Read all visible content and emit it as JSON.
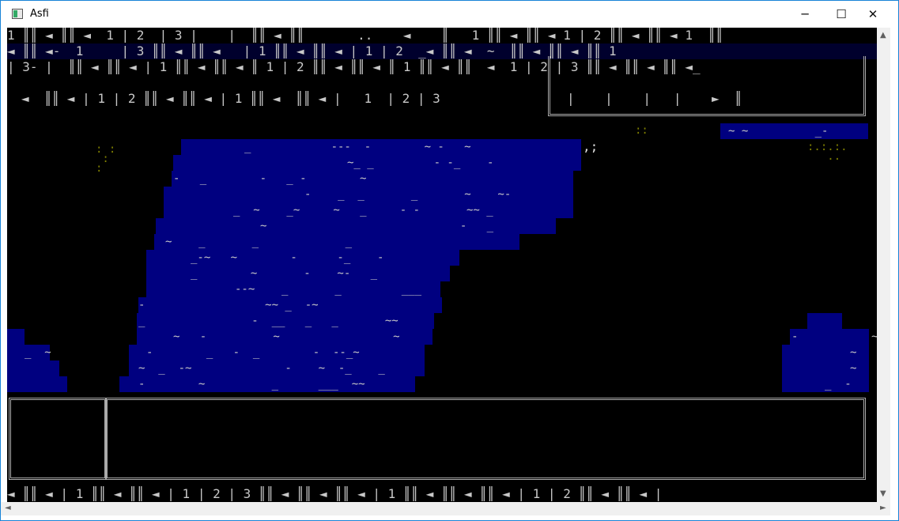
{
  "window": {
    "title": "Asfi",
    "controls": {
      "minimize": "─",
      "maximize": "☐",
      "close": "✕"
    }
  },
  "status": {
    "row1": "1 ║║ ◄ ║║ ◄  1 | 2  | 3 |    |  ║║ ◄ ║║       ..    ◄    ║   1 ║║ ◄ ║║ ◄ 1 | 2 ║║ ◄ ║║ ◄ 1  ║║",
    "row2": "◄ ║║ ◄-  1     | 3 ║║ ◄ ║║ ◄   | 1 ║║ ◄ ║║ ◄ | 1 | 2  _◄ ║║ ◄  ~  ║║ ◄ ║║ ◄ ║║ 1",
    "row3": "| 3- |  ║║ ◄ ║║ ◄ | 1 ║║ ◄ ║║ ◄ ║ 1 | 2 ║║ ◄ ║║ ◄ ║ 1 ║║ ◄ ║║  ◄  1 | 2 | 3 ║║ ◄ ║║ ◄ ║║ ◄_",
    "row4": "◄  ║║ ◄ | 1 | 2 ║║ ◄ ║║ ◄ | 1 ║║ ◄  ║║ ◄ |   1  | 2 | 3",
    "row4_side": "|    |    |   |    ►  ║",
    "bottom": "◄ ║║ ◄ | 1 ║║ ◄ ║║ ◄ | 1 | 2 | 3 ║║ ◄ ║║ ◄ ║║ ◄ | 1 ║║ ◄ ║║ ◄ ║║ ◄ | 1 | 2 ║║ ◄ ║║ ◄ |"
  },
  "map": {
    "topright_band": "~ ~          _-",
    "shore_mark": ",;",
    "dots_left": ": :\n :\n:",
    "dots_right": ":.:.:.\n   ..",
    "dots_top": "::"
  },
  "colors": {
    "water": "#000080",
    "terminal_bg": "#000000",
    "text": "#c8c8c8",
    "olive": "#808000"
  }
}
